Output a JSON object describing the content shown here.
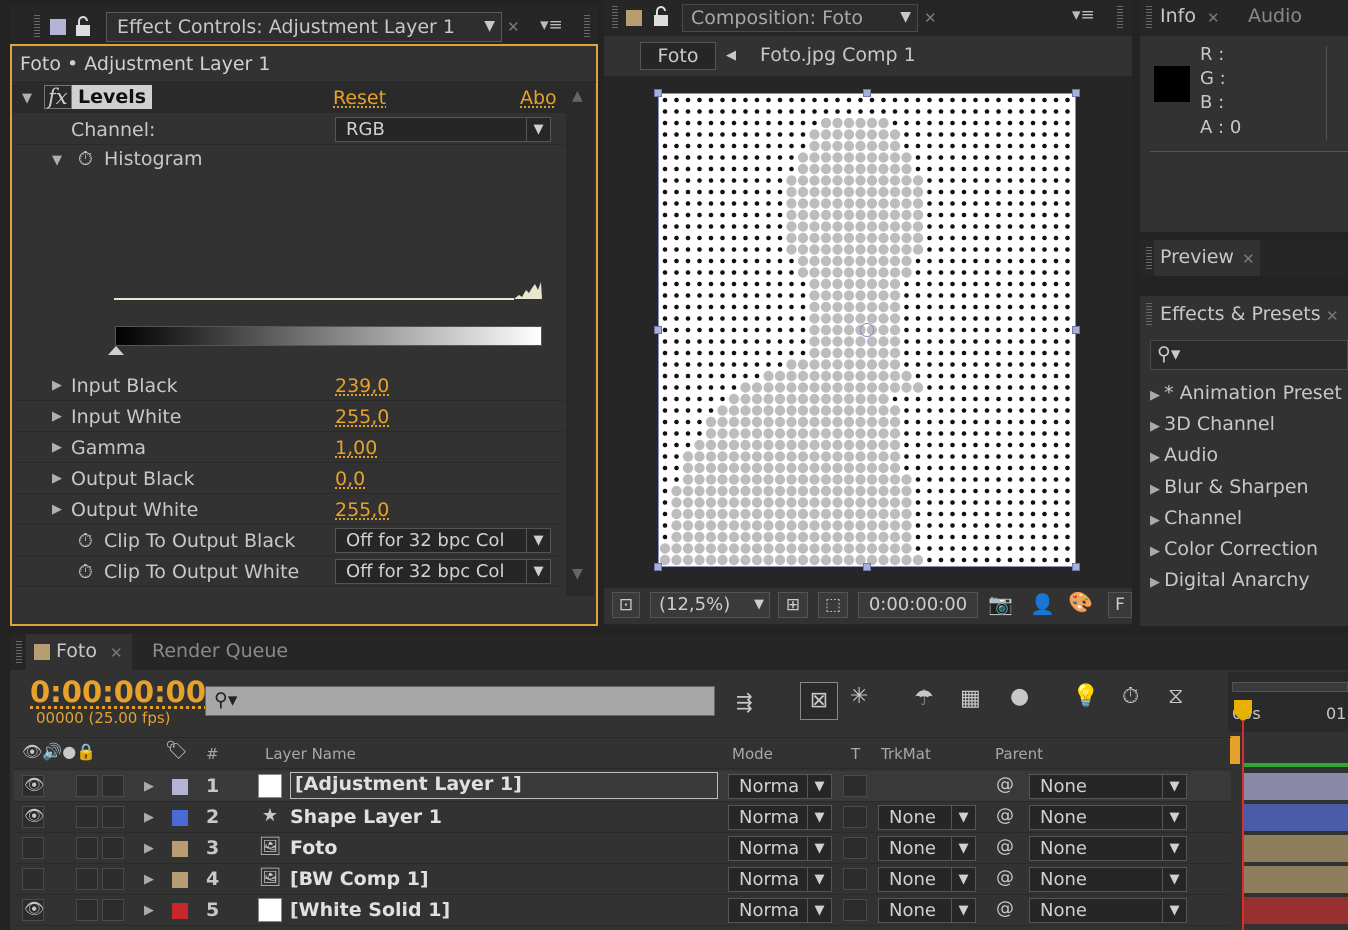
{
  "effect_controls": {
    "tab_title": "Effect Controls: Adjustment Layer 1",
    "breadcrumb": "Foto • Adjustment Layer 1",
    "effect_name": "Levels",
    "reset_label": "Reset",
    "about_label": "Abo",
    "channel_label": "Channel:",
    "channel_value": "RGB",
    "histogram_label": "Histogram",
    "params": [
      {
        "label": "Input Black",
        "value": "239,0"
      },
      {
        "label": "Input White",
        "value": "255,0"
      },
      {
        "label": "Gamma",
        "value": "1,00"
      },
      {
        "label": "Output Black",
        "value": "0,0"
      },
      {
        "label": "Output White",
        "value": "255,0"
      }
    ],
    "clip_black_label": "Clip To Output Black",
    "clip_black_value": "Off for 32 bpc Col",
    "clip_white_label": "Clip To Output White",
    "clip_white_value": "Off for 32 bpc Col"
  },
  "composition": {
    "tab_title": "Composition: Foto",
    "nav_current": "Foto",
    "nav_next": "Foto.jpg Comp 1",
    "zoom": "(12,5%)",
    "timecode": "0:00:00:00",
    "footer_f": "F"
  },
  "info": {
    "tab_info": "Info",
    "tab_audio": "Audio",
    "r_label": "R :",
    "g_label": "G :",
    "b_label": "B :",
    "a_label": "A : 0"
  },
  "preview": {
    "tab_title": "Preview"
  },
  "effects_presets": {
    "tab_title": "Effects & Presets",
    "items": [
      "* Animation Preset",
      "3D Channel",
      "Audio",
      "Blur & Sharpen",
      "Channel",
      "Color Correction",
      "Digital Anarchy"
    ]
  },
  "timeline": {
    "tab_foto": "Foto",
    "tab_render": "Render Queue",
    "timecode": "0:00:00:00",
    "frame_info": "00000 (25.00 fps)",
    "ruler_start": "00s",
    "ruler_next": "01",
    "col_hash": "#",
    "col_layer_name": "Layer Name",
    "col_mode": "Mode",
    "col_t": "T",
    "col_trkmat": "TrkMat",
    "col_parent": "Parent",
    "layers": [
      {
        "num": "1",
        "name": "[Adjustment Layer 1]",
        "mode": "Norma",
        "trkmat": "",
        "parent": "None",
        "color": "#b4b4d8",
        "bar": "#8a8aa8"
      },
      {
        "num": "2",
        "name": "Shape Layer 1",
        "mode": "Norma",
        "trkmat": "None",
        "parent": "None",
        "color": "#4a6ad8",
        "bar": "#4a5ca8"
      },
      {
        "num": "3",
        "name": "Foto",
        "mode": "Norma",
        "trkmat": "None",
        "parent": "None",
        "color": "#b89c72",
        "bar": "#8f7e5e"
      },
      {
        "num": "4",
        "name": "[BW Comp 1]",
        "mode": "Norma",
        "trkmat": "None",
        "parent": "None",
        "color": "#b89c72",
        "bar": "#8f7e5e"
      },
      {
        "num": "5",
        "name": "[White Solid 1]",
        "mode": "Norma",
        "trkmat": "None",
        "parent": "None",
        "color": "#c8282a",
        "bar": "#983030"
      }
    ]
  },
  "colors": {
    "accent": "#e6a22b",
    "panel": "#323232",
    "tabbar": "#262626"
  }
}
